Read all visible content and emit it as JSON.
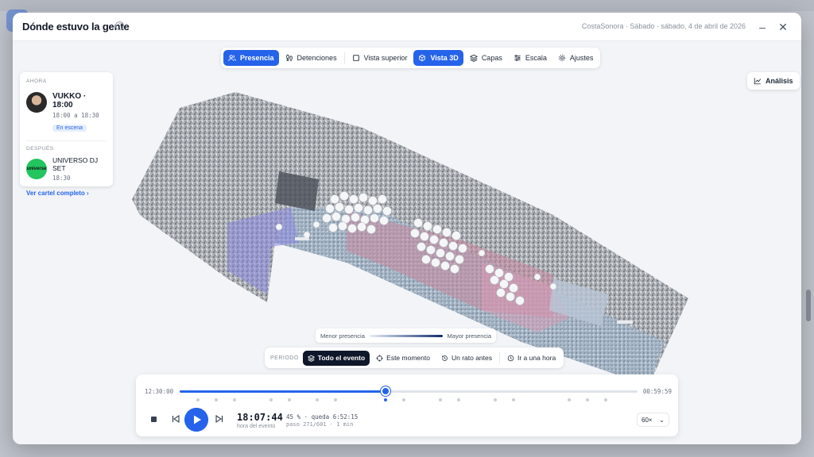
{
  "window": {
    "title": "Dónde estuvo la gente",
    "subtitle": "CostaSonora · Sábado · sábado, 4 de abril de 2026",
    "help_icon": "help-circle-icon",
    "minimize_icon": "minus-icon",
    "close_icon": "x-icon"
  },
  "toolbar": {
    "items": [
      {
        "label": "Presencia",
        "icon": "users-icon",
        "active": true
      },
      {
        "label": "Detenciones",
        "icon": "footprints-icon",
        "active": false
      },
      {
        "label": "Vista superior",
        "icon": "square-icon",
        "active": false
      },
      {
        "label": "Vista 3D",
        "icon": "cube-icon",
        "active": true
      },
      {
        "label": "Capas",
        "icon": "layers-icon",
        "active": false
      },
      {
        "label": "Escala",
        "icon": "sliders-icon",
        "active": false
      },
      {
        "label": "Ajustes",
        "icon": "gear-icon",
        "active": false
      }
    ]
  },
  "analysis": {
    "label": "Análisis",
    "icon": "chart-line-icon"
  },
  "lineup": {
    "now_label": "AHORA",
    "now": {
      "name": "VUKKO · 18:00",
      "time": "18:00 a 18:30",
      "status": "En escena"
    },
    "next_label": "DESPUÉS",
    "next": {
      "name": "UNIVERSO DJ SET",
      "time": "18:30",
      "avatar_text": "universe"
    },
    "link": "Ver cartel completo"
  },
  "legend": {
    "min_label": "Menor presencia",
    "max_label": "Mayor presencia"
  },
  "period": {
    "label": "PERIODO",
    "options": [
      {
        "label": "Todo el evento",
        "icon": "layers-icon",
        "active": true
      },
      {
        "label": "Este momento",
        "icon": "crosshair-icon",
        "active": false
      },
      {
        "label": "Un rato antes",
        "icon": "history-icon",
        "active": false
      },
      {
        "label": "Ir a una hora",
        "icon": "clock-icon",
        "active": false
      }
    ]
  },
  "timeline": {
    "start": "12:30:00",
    "end": "00:59:59",
    "progress": 0.45,
    "markers": [
      0.04,
      0.08,
      0.12,
      0.2,
      0.24,
      0.3,
      0.34,
      0.45,
      0.49,
      0.57,
      0.61,
      0.69,
      0.73,
      0.85,
      0.89,
      0.93
    ],
    "current_time": "18:07:44",
    "current_time_label": "hora del evento",
    "progress_text": "45 % · queda 6:52:15",
    "step_text": "paso 271/601 · 1 min",
    "speed": "60×"
  }
}
